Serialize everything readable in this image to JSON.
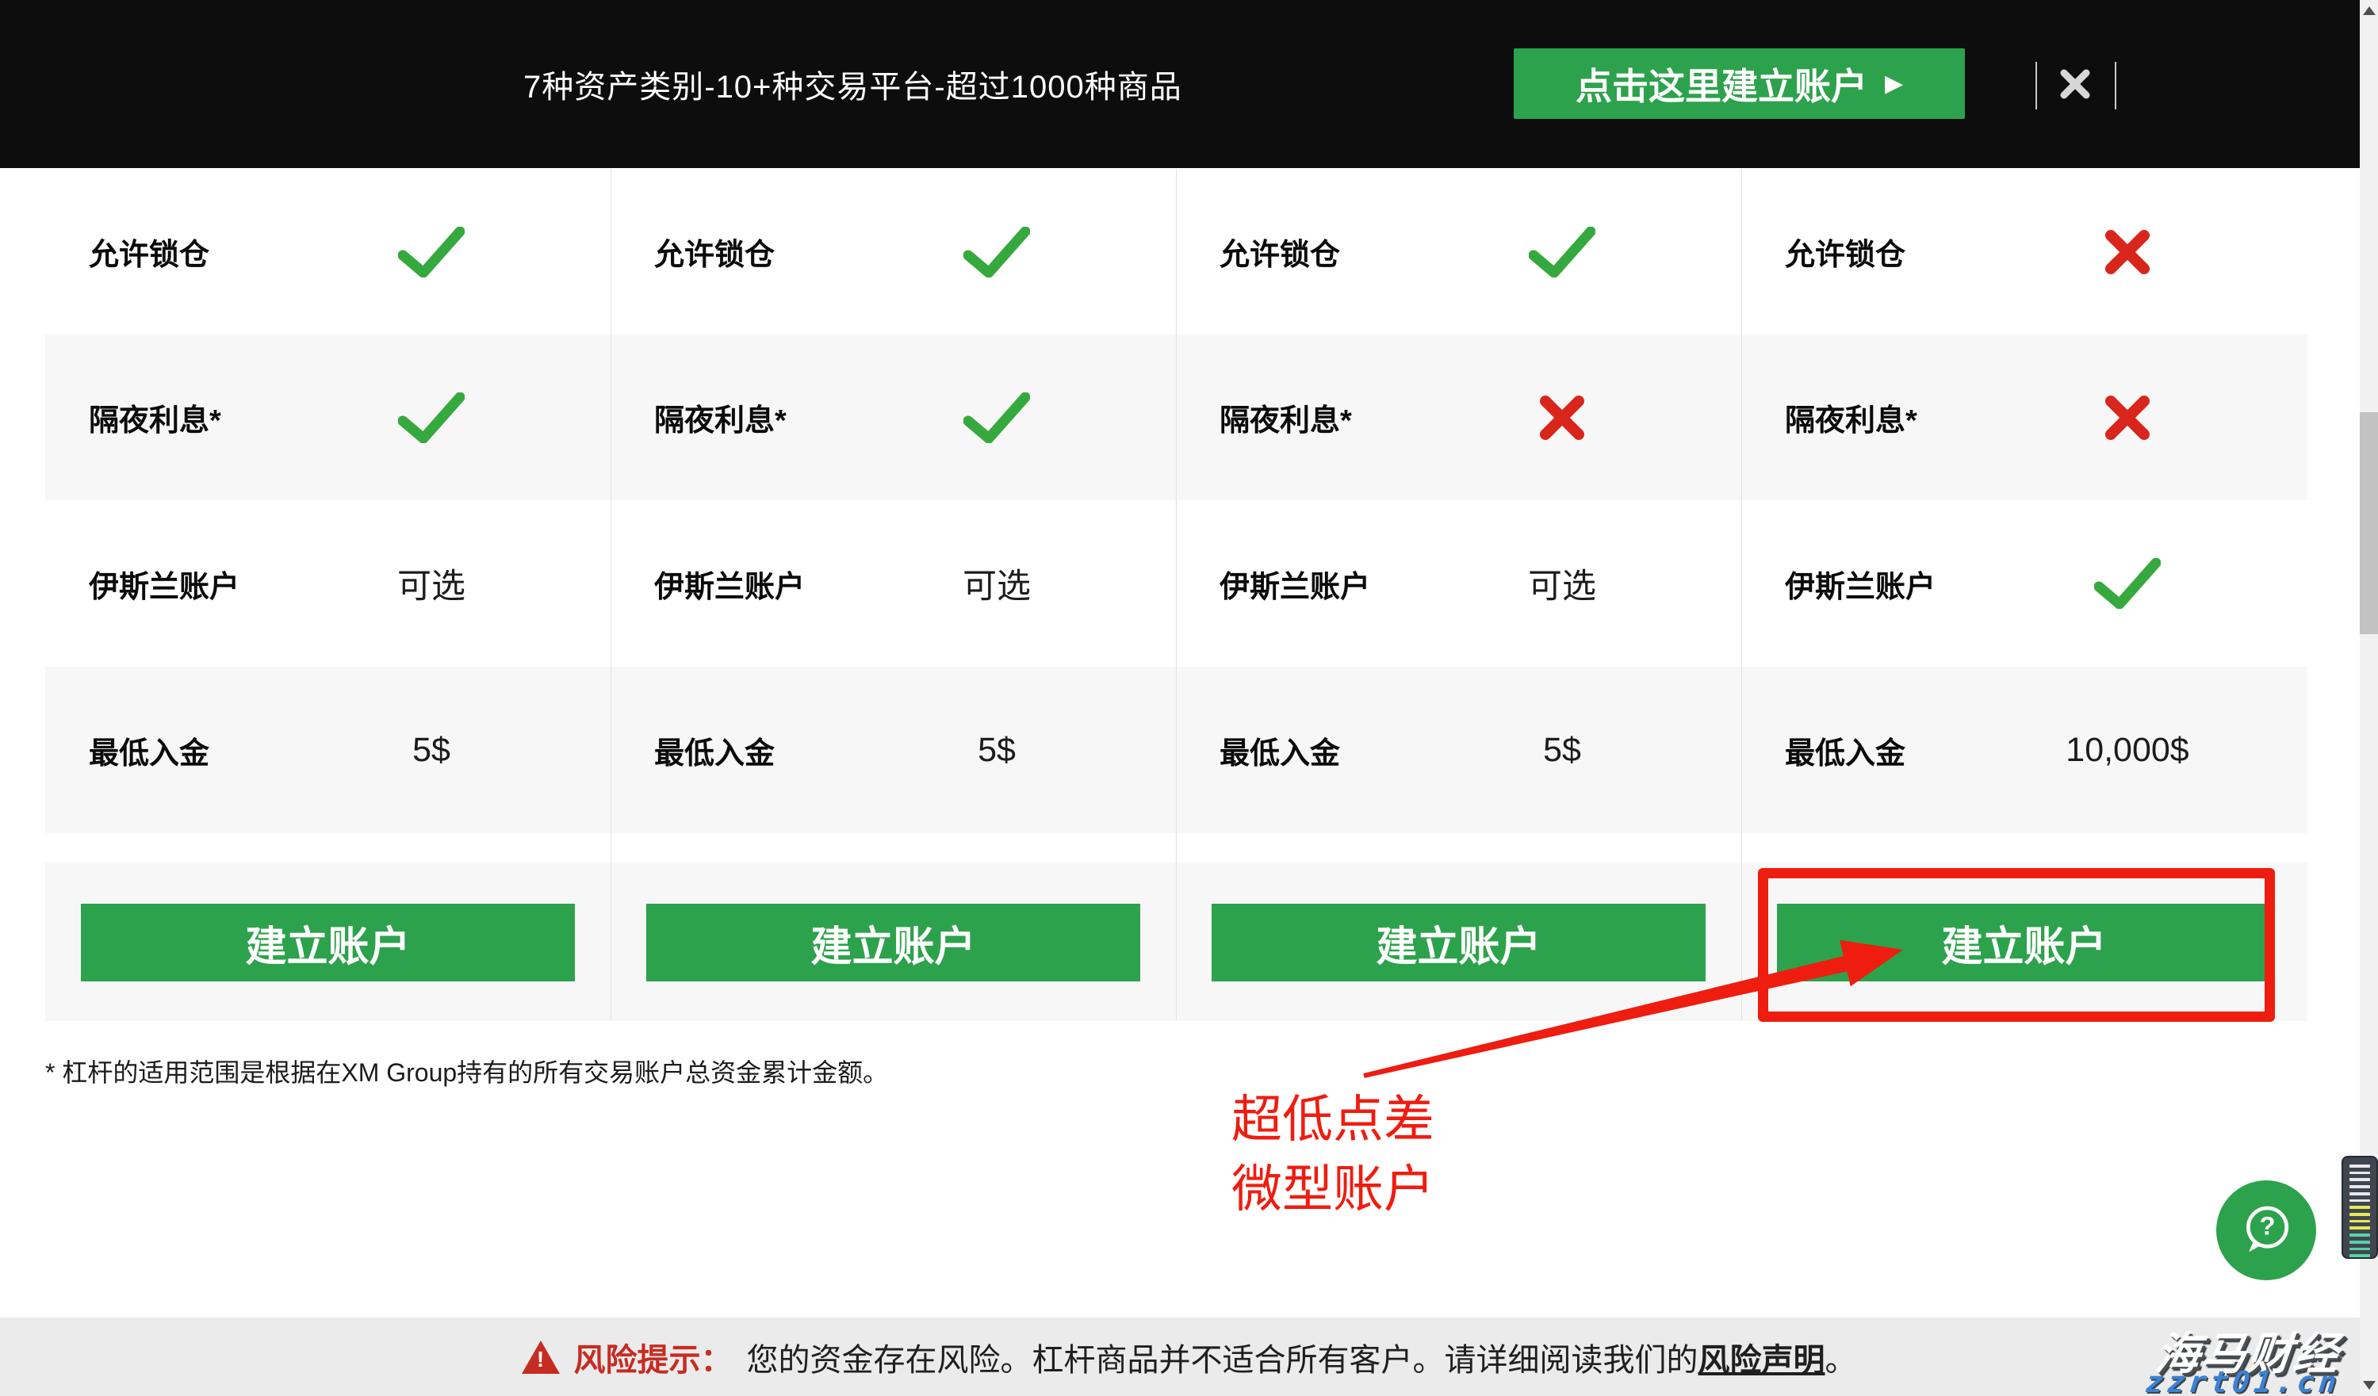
{
  "header": {
    "headline": "7种资产类别-10+种交易平台-超过1000种商品",
    "cta_label": "点击这里建立账户",
    "cta_arrow": "▶"
  },
  "table": {
    "row_labels": [
      "允许锁仓",
      "隔夜利息*",
      "伊斯兰账户",
      "最低入金"
    ],
    "columns": [
      {
        "cells": [
          {
            "kind": "check"
          },
          {
            "kind": "check"
          },
          {
            "kind": "text",
            "text": "可选"
          },
          {
            "kind": "text",
            "text": "5$"
          }
        ],
        "button_label": "建立账户"
      },
      {
        "cells": [
          {
            "kind": "check"
          },
          {
            "kind": "check"
          },
          {
            "kind": "text",
            "text": "可选"
          },
          {
            "kind": "text",
            "text": "5$"
          }
        ],
        "button_label": "建立账户"
      },
      {
        "cells": [
          {
            "kind": "check"
          },
          {
            "kind": "cross"
          },
          {
            "kind": "text",
            "text": "可选"
          },
          {
            "kind": "text",
            "text": "5$"
          }
        ],
        "button_label": "建立账户"
      },
      {
        "cells": [
          {
            "kind": "cross"
          },
          {
            "kind": "cross"
          },
          {
            "kind": "check"
          },
          {
            "kind": "text",
            "text": "10,000$"
          }
        ],
        "button_label": "建立账户"
      }
    ]
  },
  "footnote": "* 杠杆的适用范围是根据在XM Group持有的所有交易账户总资金累计金额。",
  "annotation": {
    "line1": "超低点差",
    "line2": "微型账户"
  },
  "chat": {
    "icon": "question-bubble",
    "glyph": "?"
  },
  "risk_bar": {
    "label": "风险提示：",
    "text": "您的资金存在风险。杠杆商品并不适合所有客户。请详细阅读我们的",
    "link": "风险声明",
    "suffix": "。"
  },
  "watermark": {
    "title": "海马财经",
    "subtitle": "zzrt01.cn"
  },
  "colors": {
    "header_bg": "#0d0d0d",
    "green": "#2da24c",
    "check_green": "#36a93e",
    "cross_red": "#d9261c",
    "annotation_red": "#ee1d10",
    "risk_red": "#c62c22",
    "watermark_blue": "#3b82d4",
    "row_alt_gray": "#f7f7f7"
  }
}
